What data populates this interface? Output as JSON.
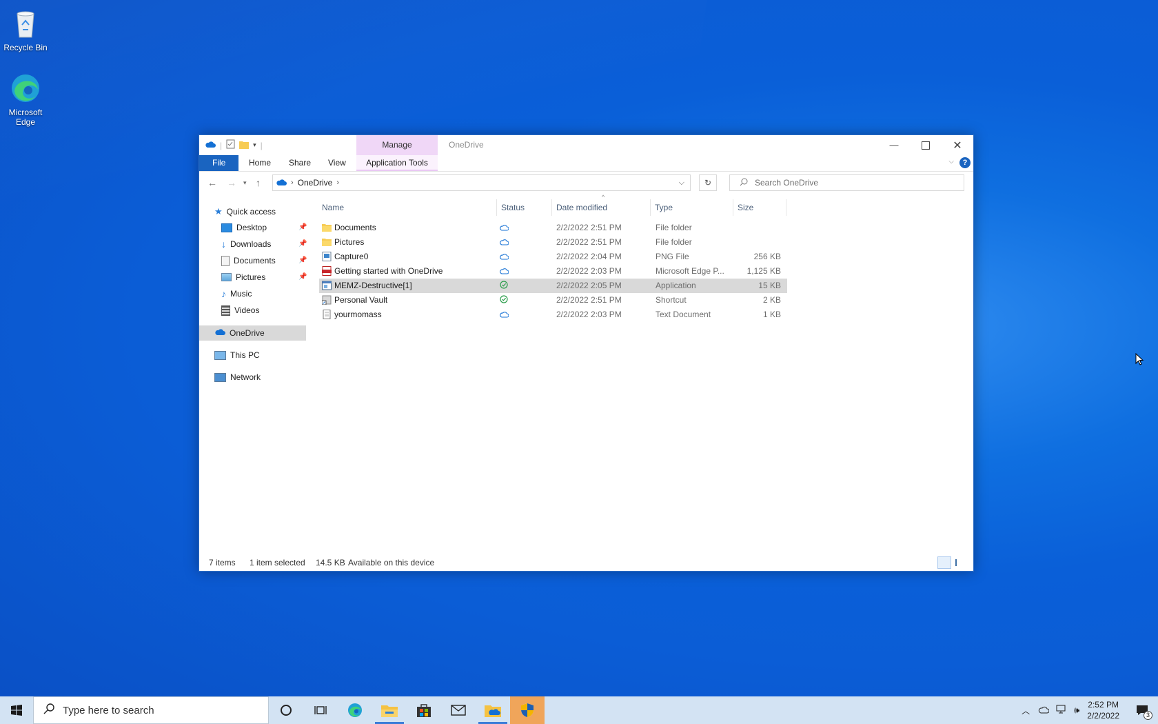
{
  "desktop": {
    "icons": [
      {
        "label": "Recycle Bin",
        "icon": "recycle-bin-icon"
      },
      {
        "label": "Microsoft Edge",
        "icon": "edge-icon"
      }
    ]
  },
  "window": {
    "title": "OneDrive",
    "contextual_tab_group": "Manage",
    "ribbon_tabs": [
      "File",
      "Home",
      "Share",
      "View",
      "Application Tools"
    ],
    "address": {
      "crumbs": [
        "OneDrive"
      ]
    },
    "search": {
      "placeholder": "Search OneDrive"
    },
    "nav": {
      "quick_access": "Quick access",
      "items": [
        {
          "label": "Desktop",
          "pinned": true
        },
        {
          "label": "Downloads",
          "pinned": true
        },
        {
          "label": "Documents",
          "pinned": true
        },
        {
          "label": "Pictures",
          "pinned": true
        },
        {
          "label": "Music",
          "pinned": false
        },
        {
          "label": "Videos",
          "pinned": false
        }
      ],
      "onedrive": "OneDrive",
      "this_pc": "This PC",
      "network": "Network"
    },
    "columns": {
      "name": "Name",
      "status": "Status",
      "date": "Date modified",
      "type": "Type",
      "size": "Size"
    },
    "files": [
      {
        "name": "Documents",
        "status": "cloud",
        "date": "2/2/2022 2:51 PM",
        "type": "File folder",
        "size": "",
        "icon": "folder-icon"
      },
      {
        "name": "Pictures",
        "status": "cloud",
        "date": "2/2/2022 2:51 PM",
        "type": "File folder",
        "size": "",
        "icon": "folder-icon"
      },
      {
        "name": "Capture0",
        "status": "cloud",
        "date": "2/2/2022 2:04 PM",
        "type": "PNG File",
        "size": "256 KB",
        "icon": "image-file-icon"
      },
      {
        "name": "Getting started with OneDrive",
        "status": "cloud",
        "date": "2/2/2022 2:03 PM",
        "type": "Microsoft Edge P...",
        "size": "1,125 KB",
        "icon": "pdf-file-icon"
      },
      {
        "name": "MEMZ-Destructive[1]",
        "status": "available",
        "date": "2/2/2022 2:05 PM",
        "type": "Application",
        "size": "15 KB",
        "icon": "application-icon"
      },
      {
        "name": "Personal Vault",
        "status": "available",
        "date": "2/2/2022 2:51 PM",
        "type": "Shortcut",
        "size": "2 KB",
        "icon": "shortcut-icon"
      },
      {
        "name": "yourmomass",
        "status": "cloud",
        "date": "2/2/2022 2:03 PM",
        "type": "Text Document",
        "size": "1 KB",
        "icon": "text-file-icon"
      }
    ],
    "selected_index": 4,
    "status_bar": {
      "count": "7 items",
      "selection": "1 item selected",
      "size": "14.5 KB",
      "availability": "Available on this device"
    }
  },
  "taskbar": {
    "search_placeholder": "Type here to search",
    "time": "2:52 PM",
    "date": "2/2/2022",
    "notification_count": "3"
  }
}
